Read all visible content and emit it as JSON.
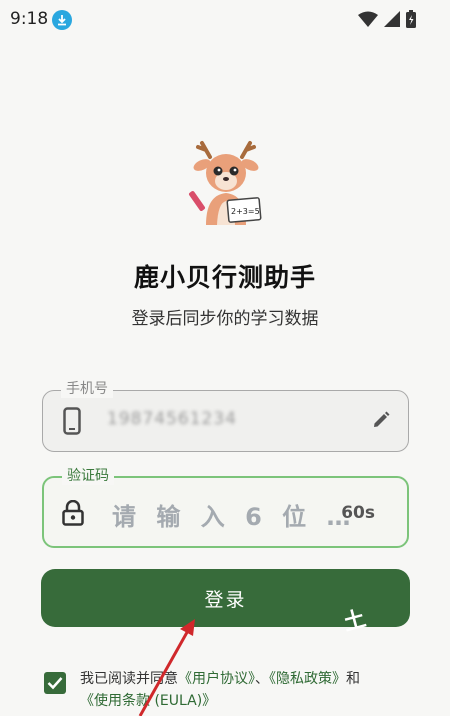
{
  "status_bar": {
    "time": "9:18",
    "icons": [
      "download-icon",
      "wifi-icon",
      "cellular-signal-icon",
      "battery-icon"
    ]
  },
  "app": {
    "title": "鹿小贝行测助手",
    "subtitle": "登录后同步你的学习数据",
    "logo_text": "2+3=5"
  },
  "phone_field": {
    "label": "手机号",
    "value": "19874561234"
  },
  "code_field": {
    "label": "验证码",
    "placeholder": "请 输 入 6 位 …",
    "countdown": "60s"
  },
  "login_button": {
    "label": "登录"
  },
  "watermark": "土",
  "agreement": {
    "checked": true,
    "prefix": "我已阅读并同意",
    "user_agreement": "《用户协议》",
    "sep": "、",
    "privacy_policy": "《隐私政策》",
    "and": "和",
    "eula": "《使用条款 (EULA)》"
  },
  "colors": {
    "primary": "#376b3a",
    "focus_border": "#7cc47a",
    "annotation_arrow": "#d0282b"
  }
}
